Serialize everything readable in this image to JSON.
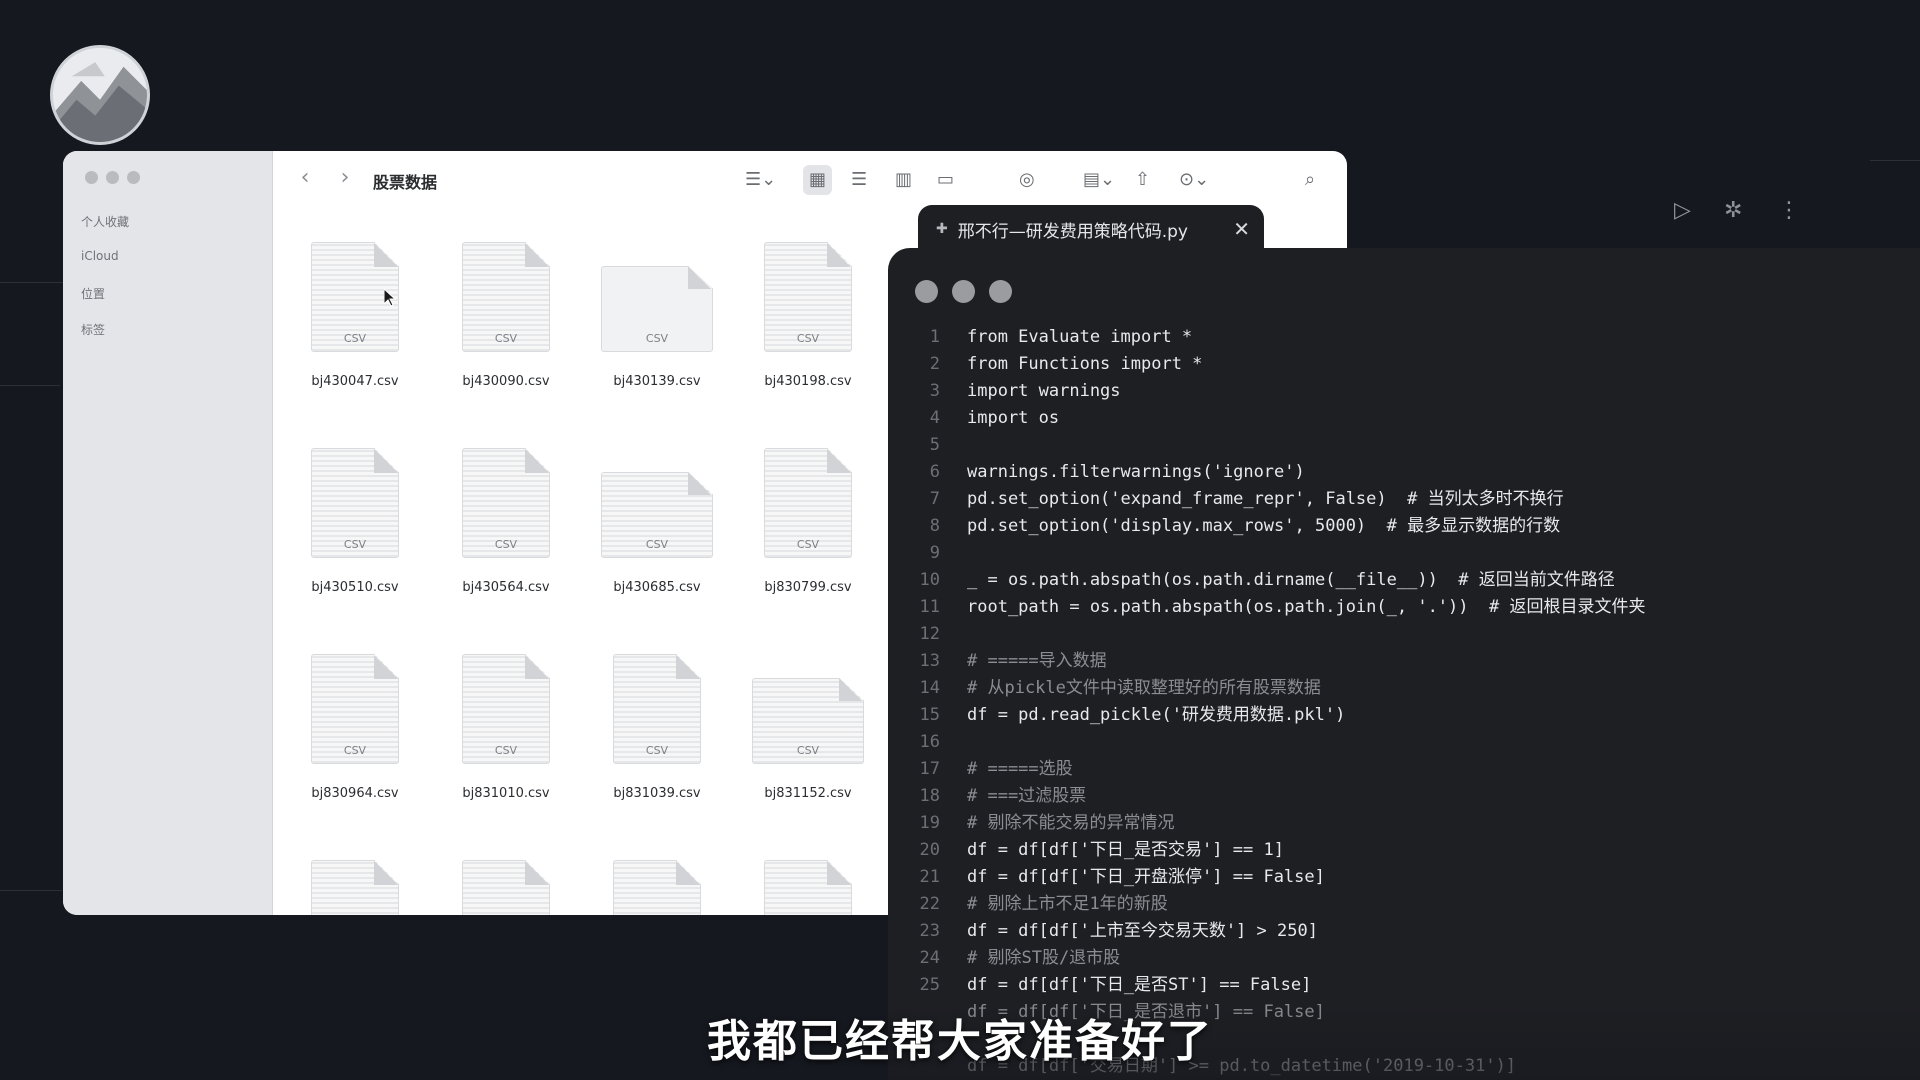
{
  "finder": {
    "title": "股票数据",
    "sidebar": [
      "个人收藏",
      "iCloud",
      "位置",
      "标签"
    ],
    "files": [
      "bj430047.csv",
      "bj430090.csv",
      "bj430139.csv",
      "bj430198.csv",
      "bj430510.csv",
      "bj430564.csv",
      "bj430685.csv",
      "bj830799.csv",
      "bj830964.csv",
      "bj831010.csv",
      "bj831039.csv",
      "bj831152.csv"
    ],
    "file_tag": "CSV",
    "nav_back": "‹",
    "nav_forward": "›"
  },
  "editor": {
    "tab_title": "邢不行—研发费用策略代码.py",
    "tab_close": "✕",
    "lines": [
      {
        "n": "1",
        "t": "from Evaluate import *"
      },
      {
        "n": "2",
        "t": "from Functions import *"
      },
      {
        "n": "3",
        "t": "import warnings"
      },
      {
        "n": "4",
        "t": "import os"
      },
      {
        "n": "5",
        "t": ""
      },
      {
        "n": "6",
        "t": "warnings.filterwarnings('ignore')"
      },
      {
        "n": "7",
        "t": "pd.set_option('expand_frame_repr', False)  # 当列太多时不换行"
      },
      {
        "n": "8",
        "t": "pd.set_option('display.max_rows', 5000)  # 最多显示数据的行数"
      },
      {
        "n": "9",
        "t": ""
      },
      {
        "n": "10",
        "t": "_ = os.path.abspath(os.path.dirname(__file__))  # 返回当前文件路径"
      },
      {
        "n": "11",
        "t": "root_path = os.path.abspath(os.path.join(_, '.'))  # 返回根目录文件夹"
      },
      {
        "n": "12",
        "t": ""
      },
      {
        "n": "13",
        "t": "# =====导入数据"
      },
      {
        "n": "14",
        "t": "# 从pickle文件中读取整理好的所有股票数据"
      },
      {
        "n": "15",
        "t": "df = pd.read_pickle('研发费用数据.pkl')"
      },
      {
        "n": "16",
        "t": ""
      },
      {
        "n": "17",
        "t": "# =====选股"
      },
      {
        "n": "18",
        "t": "# ===过滤股票"
      },
      {
        "n": "19",
        "t": "# 剔除不能交易的异常情况"
      },
      {
        "n": "20",
        "t": "df = df[df['下日_是否交易'] == 1]"
      },
      {
        "n": "21",
        "t": "df = df[df['下日_开盘涨停'] == False]"
      },
      {
        "n": "22",
        "t": "# 剔除上市不足1年的新股"
      },
      {
        "n": "23",
        "t": "df = df[df['上市至今交易天数'] > 250]"
      },
      {
        "n": "24",
        "t": "# 剔除ST股/退市股"
      },
      {
        "n": "25",
        "t": "df = df[df['下日_是否ST'] == False]"
      },
      {
        "n": "",
        "t": "df = df[df['下日_是否退市'] == False]"
      },
      {
        "n": "",
        "t": ""
      },
      {
        "n": "",
        "t": "df = df[df['交易日期'] >= pd.to_datetime('2019-10-31')]"
      }
    ]
  },
  "subtitle": "我都已经帮大家准备好了",
  "icons": {
    "toolbar": [
      "list-sort-icon",
      "grid-view-icon",
      "list-view-icon",
      "column-view-icon",
      "gallery-view-icon",
      "airdrop-icon",
      "group-icon",
      "share-icon",
      "more-icon",
      "search-icon"
    ],
    "editor": [
      "run-icon",
      "debug-icon",
      "more-vertical-icon"
    ]
  }
}
